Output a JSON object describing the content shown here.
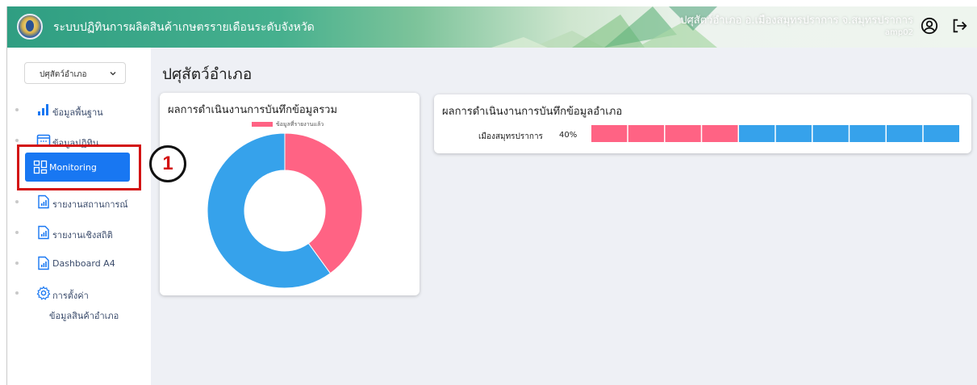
{
  "header": {
    "app_title": "ระบบปฏิทินการผลิตสินค้าเกษตรรายเดือนระดับจังหวัด",
    "user_position": "ปศุสัตว์อำเภอ อ.เมืองสมุทรปราการ จ.สมุทรปราการ",
    "username": "amp02"
  },
  "sidebar": {
    "dropdown_value": "ปศุสัตว์อำเภอ",
    "items": [
      {
        "label": "ข้อมูลพื้นฐาน",
        "icon": "bar-chart-icon"
      },
      {
        "label": "ข้อมูลปฏิทิน",
        "icon": "calendar-icon"
      },
      {
        "label": "Monitoring",
        "icon": "dashboard-grid-icon",
        "active": true
      },
      {
        "label": "รายงานสถานการณ์",
        "icon": "report-icon"
      },
      {
        "label": "รายงานเชิงสถิติ",
        "icon": "report-icon"
      },
      {
        "label": "Dashboard A4",
        "icon": "report-icon"
      },
      {
        "label": "การตั้งค่า",
        "icon": "gear-icon"
      }
    ],
    "sub_item": "ข้อมูลสินค้าอำเภอ"
  },
  "main": {
    "page_title": "ปศุสัตว์อำเภอ",
    "overall_card": {
      "title": "ผลการดำเนินงานการบันทึกข้อมูลรวม",
      "legend_label": "ข้อมูลที่รายงานแล้ว"
    },
    "district_card": {
      "title": "ผลการดำเนินงานการบันทึกข้อมูลอำเภอ",
      "district_name": "เมืองสมุทรปราการ",
      "percent_label": "40%"
    }
  },
  "annotation": {
    "number": "1"
  },
  "colors": {
    "reported": "#ff6384",
    "not_reported": "#36a2eb",
    "active": "#1877f2"
  },
  "chart_data": [
    {
      "type": "pie",
      "title": "ผลการดำเนินงานการบันทึกข้อมูลรวม",
      "labels": [
        "ข้อมูลที่รายงานแล้ว",
        ""
      ],
      "values": [
        40,
        60
      ],
      "colors": [
        "#ff6384",
        "#36a2eb"
      ]
    },
    {
      "type": "bar",
      "title": "ผลการดำเนินงานการบันทึกข้อมูลอำเภอ",
      "categories": [
        "เมืองสมุทรปราการ"
      ],
      "values": [
        40
      ],
      "segments_total": 10,
      "segments_filled": 4
    }
  ]
}
